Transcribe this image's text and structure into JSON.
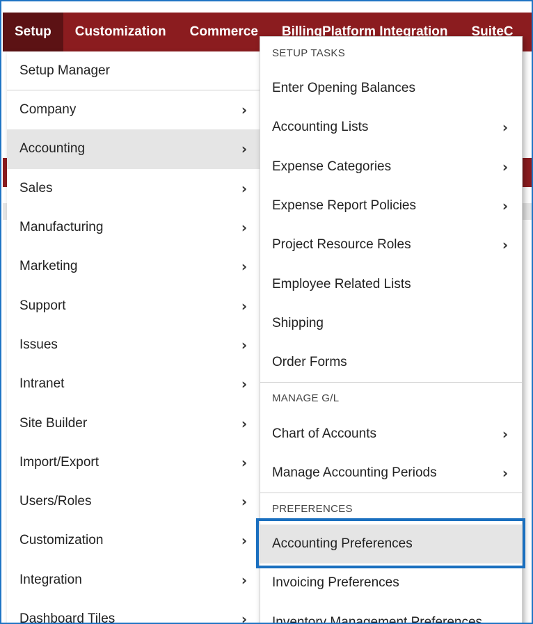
{
  "topnav": {
    "tabs": [
      {
        "label": "Setup"
      },
      {
        "label": "Customization"
      },
      {
        "label": "Commerce"
      },
      {
        "label": "BillingPlatform Integration"
      },
      {
        "label": "SuiteC"
      }
    ]
  },
  "setup_menu": {
    "top_item": "Setup Manager",
    "items": [
      {
        "label": "Company"
      },
      {
        "label": "Accounting"
      },
      {
        "label": "Sales"
      },
      {
        "label": "Manufacturing"
      },
      {
        "label": "Marketing"
      },
      {
        "label": "Support"
      },
      {
        "label": "Issues"
      },
      {
        "label": "Intranet"
      },
      {
        "label": "Site Builder"
      },
      {
        "label": "Import/Export"
      },
      {
        "label": "Users/Roles"
      },
      {
        "label": "Customization"
      },
      {
        "label": "Integration"
      },
      {
        "label": "Dashboard Tiles"
      }
    ],
    "chevron": "›"
  },
  "accounting_submenu": {
    "setup_tasks_label": "SETUP TASKS",
    "setup_tasks": [
      {
        "label": "Enter Opening Balances"
      },
      {
        "label": "Accounting Lists"
      },
      {
        "label": "Expense Categories"
      },
      {
        "label": "Expense Report Policies"
      },
      {
        "label": "Project Resource Roles"
      },
      {
        "label": "Employee Related Lists"
      },
      {
        "label": "Shipping"
      },
      {
        "label": "Order Forms"
      }
    ],
    "manage_gl_label": "MANAGE G/L",
    "manage_gl": [
      {
        "label": "Chart of Accounts"
      },
      {
        "label": "Manage Accounting Periods"
      }
    ],
    "preferences_label": "PREFERENCES",
    "preferences": [
      {
        "label": "Accounting Preferences"
      },
      {
        "label": "Invoicing Preferences"
      },
      {
        "label": "Inventory Management Preferences"
      }
    ]
  },
  "colors": {
    "nav_bg": "#8b1c1f",
    "nav_active": "#5c1214",
    "hover_bg": "#e5e5e5",
    "highlight_border": "#1a6fbf"
  },
  "icons": {
    "submenu_chevron": "chevron-right-icon"
  }
}
